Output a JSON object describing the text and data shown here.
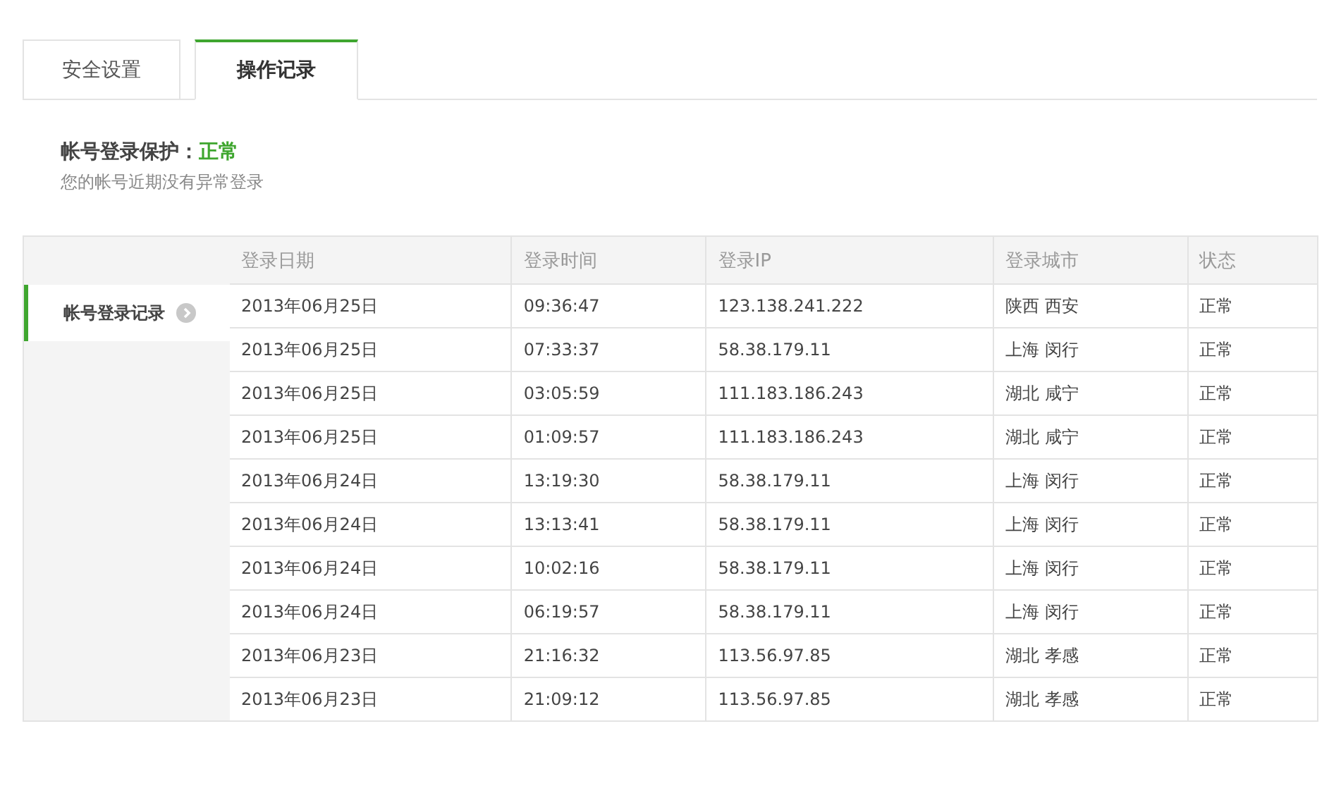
{
  "tabs": [
    {
      "label": "安全设置",
      "selected": false
    },
    {
      "label": "操作记录",
      "selected": true
    }
  ],
  "protection": {
    "label": "帐号登录保护：",
    "status": "正常",
    "note": "您的帐号近期没有异常登录"
  },
  "sidebar": {
    "items": [
      {
        "label": "帐号登录记录",
        "selected": true
      }
    ]
  },
  "table": {
    "columns": [
      "登录日期",
      "登录时间",
      "登录IP",
      "登录城市",
      "状态"
    ],
    "rows": [
      [
        "2013年06月25日",
        "09:36:47",
        "123.138.241.222",
        "陕西 西安",
        "正常"
      ],
      [
        "2013年06月25日",
        "07:33:37",
        "58.38.179.11",
        "上海 闵行",
        "正常"
      ],
      [
        "2013年06月25日",
        "03:05:59",
        "111.183.186.243",
        "湖北 咸宁",
        "正常"
      ],
      [
        "2013年06月25日",
        "01:09:57",
        "111.183.186.243",
        "湖北 咸宁",
        "正常"
      ],
      [
        "2013年06月24日",
        "13:19:30",
        "58.38.179.11",
        "上海 闵行",
        "正常"
      ],
      [
        "2013年06月24日",
        "13:13:41",
        "58.38.179.11",
        "上海 闵行",
        "正常"
      ],
      [
        "2013年06月24日",
        "10:02:16",
        "58.38.179.11",
        "上海 闵行",
        "正常"
      ],
      [
        "2013年06月24日",
        "06:19:57",
        "58.38.179.11",
        "上海 闵行",
        "正常"
      ],
      [
        "2013年06月23日",
        "21:16:32",
        "113.56.97.85",
        "湖北 孝感",
        "正常"
      ],
      [
        "2013年06月23日",
        "21:09:12",
        "113.56.97.85",
        "湖北 孝感",
        "正常"
      ]
    ]
  }
}
